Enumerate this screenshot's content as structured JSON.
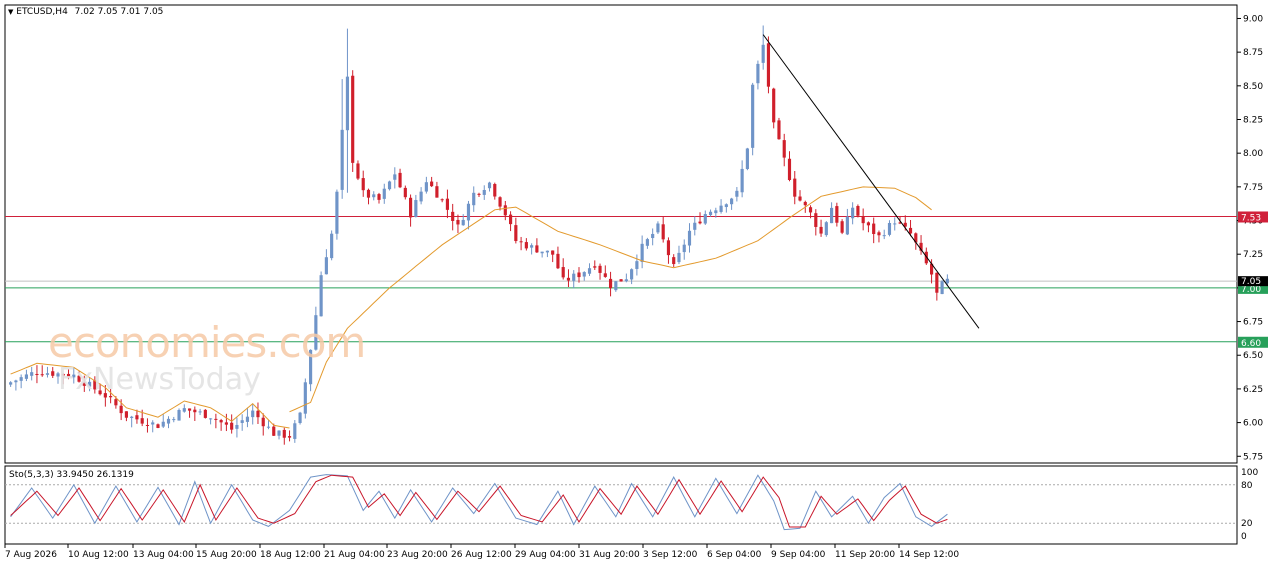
{
  "header": {
    "symbol_label": "ETCUSD,H4",
    "ohlc_label": "7.02 7.05 7.01 7.05",
    "stoch_label": "Sto(5,3,3) 33.9450 26.1319"
  },
  "watermark": {
    "brand": "economies.com",
    "sub": "FxNewsToday"
  },
  "colors": {
    "bull": "#6f94c8",
    "bear": "#d01f2b",
    "ma": "#e39a2d",
    "resistance": "#d0203a",
    "support": "#27a05a",
    "trendline": "#000000",
    "stoch_main": "#6f94c8",
    "stoch_signal": "#c8162a"
  },
  "chart_data": [
    {
      "type": "candlestick",
      "symbol": "ETCUSD",
      "timeframe": "H4",
      "ylim": [
        5.7,
        9.1
      ],
      "yticks": [
        9.0,
        8.75,
        8.5,
        8.25,
        8.0,
        7.75,
        7.5,
        7.25,
        7.0,
        6.75,
        6.5,
        6.25,
        6.0,
        5.75
      ],
      "xtick_labels": [
        "7 Aug 2026",
        "10 Aug 12:00",
        "13 Aug 04:00",
        "15 Aug 20:00",
        "18 Aug 12:00",
        "21 Aug 04:00",
        "23 Aug 20:00",
        "26 Aug 12:00",
        "29 Aug 04:00",
        "31 Aug 20:00",
        "3 Sep 12:00",
        "6 Sep 04:00",
        "9 Sep 04:00",
        "11 Sep 20:00",
        "14 Sep 12:00"
      ],
      "current_price": "7.05",
      "horizontal_levels": [
        {
          "value": 7.53,
          "label": "7.53",
          "role": "resistance"
        },
        {
          "value": 7.0,
          "label": "7.00",
          "role": "support"
        },
        {
          "value": 6.6,
          "label": "6.60",
          "role": "support"
        }
      ],
      "trendline": {
        "from": {
          "bar": 143,
          "price": 8.88
        },
        "to": {
          "bar": 184,
          "price": 6.7
        }
      },
      "anchors": [
        [
          0,
          6.3
        ],
        [
          5,
          6.38
        ],
        [
          12,
          6.35
        ],
        [
          18,
          6.2
        ],
        [
          22,
          6.05
        ],
        [
          28,
          5.98
        ],
        [
          33,
          6.1
        ],
        [
          38,
          6.05
        ],
        [
          42,
          5.95
        ],
        [
          46,
          6.08
        ],
        [
          50,
          5.92
        ],
        [
          53,
          5.9
        ],
        [
          55,
          6.05
        ],
        [
          56,
          6.3
        ],
        [
          57,
          6.55
        ],
        [
          58,
          6.8
        ],
        [
          59,
          7.1
        ],
        [
          61,
          7.4
        ],
        [
          62,
          7.7
        ],
        [
          63,
          8.15
        ],
        [
          64,
          8.55
        ],
        [
          65,
          7.95
        ],
        [
          67,
          7.7
        ],
        [
          70,
          7.65
        ],
        [
          73,
          7.85
        ],
        [
          76,
          7.55
        ],
        [
          79,
          7.8
        ],
        [
          82,
          7.65
        ],
        [
          85,
          7.45
        ],
        [
          88,
          7.7
        ],
        [
          91,
          7.78
        ],
        [
          94,
          7.55
        ],
        [
          96,
          7.35
        ],
        [
          99,
          7.3
        ],
        [
          103,
          7.25
        ],
        [
          105,
          7.05
        ],
        [
          108,
          7.1
        ],
        [
          111,
          7.18
        ],
        [
          114,
          7.02
        ],
        [
          117,
          7.08
        ],
        [
          120,
          7.3
        ],
        [
          123,
          7.45
        ],
        [
          126,
          7.15
        ],
        [
          129,
          7.42
        ],
        [
          132,
          7.55
        ],
        [
          135,
          7.62
        ],
        [
          138,
          7.7
        ],
        [
          140,
          8.05
        ],
        [
          141,
          8.5
        ],
        [
          143,
          8.8
        ],
        [
          145,
          8.2
        ],
        [
          147,
          7.95
        ],
        [
          149,
          7.7
        ],
        [
          152,
          7.55
        ],
        [
          154,
          7.4
        ],
        [
          156,
          7.6
        ],
        [
          158,
          7.4
        ],
        [
          160,
          7.6
        ],
        [
          162,
          7.48
        ],
        [
          165,
          7.38
        ],
        [
          168,
          7.5
        ],
        [
          171,
          7.4
        ],
        [
          173,
          7.25
        ],
        [
          175,
          7.1
        ],
        [
          176,
          6.95
        ],
        [
          177,
          7.02
        ],
        [
          178,
          7.05
        ]
      ],
      "bar_count": 179,
      "moving_average": {
        "anchors": [
          [
            53,
            6.08
          ],
          [
            57,
            6.15
          ],
          [
            60,
            6.45
          ],
          [
            64,
            6.7
          ],
          [
            72,
            7.0
          ],
          [
            82,
            7.32
          ],
          [
            92,
            7.58
          ],
          [
            96,
            7.6
          ],
          [
            104,
            7.42
          ],
          [
            112,
            7.32
          ],
          [
            120,
            7.2
          ],
          [
            126,
            7.15
          ],
          [
            134,
            7.22
          ],
          [
            142,
            7.35
          ],
          [
            148,
            7.52
          ],
          [
            154,
            7.68
          ],
          [
            162,
            7.75
          ],
          [
            168,
            7.74
          ],
          [
            172,
            7.67
          ],
          [
            175,
            7.58
          ]
        ]
      }
    },
    {
      "type": "line",
      "name": "Sto(5,3,3)",
      "ylim": [
        0,
        100
      ],
      "yticks": [
        100,
        80,
        20,
        0
      ],
      "levels": [
        80,
        20
      ],
      "main_value": "33.9450",
      "signal_value": "26.1319",
      "main_anchors": [
        [
          0,
          30
        ],
        [
          4,
          75
        ],
        [
          8,
          28
        ],
        [
          12,
          80
        ],
        [
          16,
          20
        ],
        [
          20,
          78
        ],
        [
          24,
          22
        ],
        [
          28,
          76
        ],
        [
          32,
          18
        ],
        [
          35,
          85
        ],
        [
          38,
          20
        ],
        [
          42,
          80
        ],
        [
          46,
          25
        ],
        [
          49,
          15
        ],
        [
          53,
          40
        ],
        [
          57,
          92
        ],
        [
          60,
          96
        ],
        [
          64,
          94
        ],
        [
          67,
          40
        ],
        [
          70,
          70
        ],
        [
          73,
          28
        ],
        [
          76,
          72
        ],
        [
          80,
          22
        ],
        [
          84,
          75
        ],
        [
          88,
          35
        ],
        [
          92,
          82
        ],
        [
          96,
          28
        ],
        [
          100,
          18
        ],
        [
          104,
          70
        ],
        [
          107,
          18
        ],
        [
          111,
          78
        ],
        [
          115,
          30
        ],
        [
          118,
          82
        ],
        [
          122,
          30
        ],
        [
          126,
          92
        ],
        [
          130,
          30
        ],
        [
          134,
          90
        ],
        [
          138,
          35
        ],
        [
          142,
          95
        ],
        [
          145,
          55
        ],
        [
          147,
          10
        ],
        [
          150,
          12
        ],
        [
          153,
          70
        ],
        [
          156,
          30
        ],
        [
          160,
          62
        ],
        [
          163,
          20
        ],
        [
          166,
          60
        ],
        [
          169,
          82
        ],
        [
          172,
          30
        ],
        [
          175,
          15
        ],
        [
          178,
          34
        ]
      ],
      "signal_anchors": [
        [
          0,
          32
        ],
        [
          5,
          70
        ],
        [
          9,
          32
        ],
        [
          13,
          75
        ],
        [
          17,
          24
        ],
        [
          21,
          74
        ],
        [
          25,
          25
        ],
        [
          29,
          72
        ],
        [
          33,
          22
        ],
        [
          36,
          80
        ],
        [
          39,
          25
        ],
        [
          43,
          75
        ],
        [
          47,
          28
        ],
        [
          50,
          20
        ],
        [
          54,
          35
        ],
        [
          58,
          85
        ],
        [
          61,
          95
        ],
        [
          65,
          92
        ],
        [
          68,
          45
        ],
        [
          71,
          66
        ],
        [
          74,
          32
        ],
        [
          77,
          68
        ],
        [
          81,
          26
        ],
        [
          85,
          70
        ],
        [
          89,
          38
        ],
        [
          93,
          78
        ],
        [
          97,
          32
        ],
        [
          101,
          22
        ],
        [
          105,
          64
        ],
        [
          108,
          22
        ],
        [
          112,
          74
        ],
        [
          116,
          34
        ],
        [
          119,
          78
        ],
        [
          123,
          34
        ],
        [
          127,
          88
        ],
        [
          131,
          34
        ],
        [
          135,
          86
        ],
        [
          139,
          38
        ],
        [
          143,
          92
        ],
        [
          146,
          60
        ],
        [
          148,
          14
        ],
        [
          151,
          14
        ],
        [
          154,
          62
        ],
        [
          157,
          34
        ],
        [
          161,
          58
        ],
        [
          164,
          24
        ],
        [
          167,
          56
        ],
        [
          170,
          78
        ],
        [
          173,
          34
        ],
        [
          176,
          20
        ],
        [
          178,
          26
        ]
      ]
    }
  ]
}
